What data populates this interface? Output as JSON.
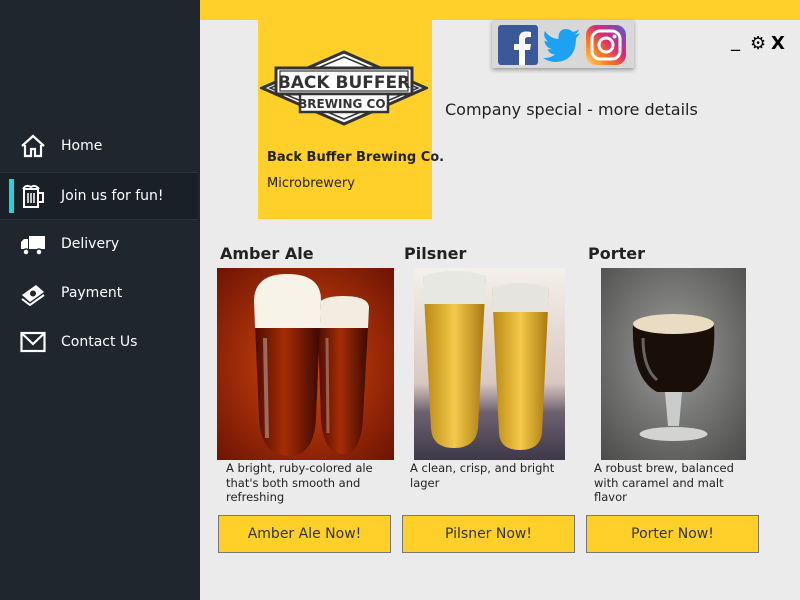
{
  "nav": [
    {
      "label": "Home",
      "icon": "home-icon"
    },
    {
      "label": "Join us for fun!",
      "icon": "beer-mug-icon"
    },
    {
      "label": "Delivery",
      "icon": "truck-icon"
    },
    {
      "label": "Payment",
      "icon": "money-icon"
    },
    {
      "label": "Contact Us",
      "icon": "mail-icon"
    }
  ],
  "active_nav": "Join us for fun!",
  "company": {
    "logo_text_1": "BACK BUFFER",
    "logo_text_2": "BREWING CO.",
    "name": "Back Buffer Brewing Co.",
    "type": "Microbrewery"
  },
  "special_text": "Company special - more details",
  "social": [
    "facebook-icon",
    "twitter-icon",
    "instagram-icon"
  ],
  "window_controls": {
    "minimize": "_",
    "settings": "⚙",
    "close": "X"
  },
  "beers": [
    {
      "title": "Amber Ale",
      "desc": "A bright, ruby-colored ale that's both smooth and refreshing",
      "button": "Amber Ale Now!"
    },
    {
      "title": "Pilsner",
      "desc": "A clean, crisp, and bright lager",
      "button": "Pilsner Now!"
    },
    {
      "title": "Porter",
      "desc": "A robust brew, balanced with caramel and malt flavor",
      "button": "Porter Now!"
    }
  ],
  "colors": {
    "accent": "#ffd02a",
    "sidebar": "#1f262e",
    "active_marker": "#21d3dc",
    "background": "#ebebeb"
  }
}
